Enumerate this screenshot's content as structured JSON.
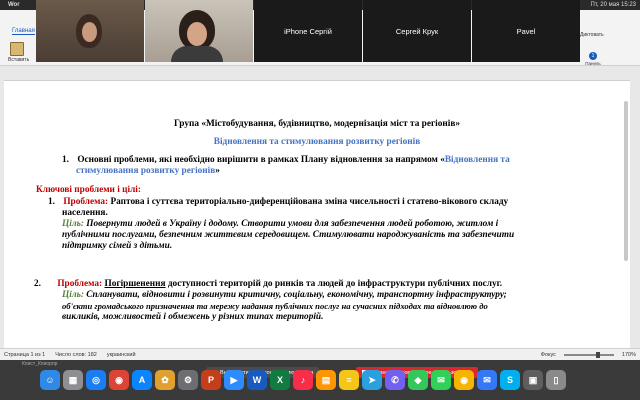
{
  "menubar": {
    "app": "Wor",
    "clock": "Пт, 20 мая  15:23"
  },
  "ribbon": {
    "home_tab": "Главная",
    "paste_label": "Вставить",
    "dictation": "Диктовать",
    "panel_label": "Панель стилей"
  },
  "tiles": [
    {
      "name": ""
    },
    {
      "name": ""
    },
    {
      "name": "iPhone Сергій"
    },
    {
      "name": "Сергей Крук"
    },
    {
      "name": "Pavel"
    }
  ],
  "doc": {
    "group_title": "Група «Містобудування, будівництво, модернізація міст та регіонів»",
    "subtitle": "Відновлення та стимулювання розвитку регіонів",
    "item1_num": "1.",
    "item1_text": "Основні проблеми, які необхідно вирішити в рамках Плану відновлення за напрямом «",
    "item1_blue": "Відновлення та",
    "item1_blue2": "стимулювання розвитку регіонів",
    "item1_end": "»",
    "key_problems": "Ключові проблеми і цілі:",
    "p1_num": "1.",
    "p1_label": "Проблема:",
    "p1_text": "Раптова і суттєва територіально-диференційована зміна чисельності і статево-вікового складу",
    "p1_text2": "населення.",
    "p1_goal_label": "Ціль:",
    "p1_goal": "Повернути людей в Україну і додому. Створити умови для забезпечення людей роботою, житлом і",
    "p1_goal2": "публічними послугами, безпечним життєвим середовищем. Стимулювати народжуваність та забезпечити",
    "p1_goal3": "підтримку сімей з дітьми.",
    "p2_num": "2.",
    "p2_label": "Проблема:",
    "p2_under": "Погіршенення",
    "p2_text": "доступності територій до ринків та людей до інфраструктури публічних послуг.",
    "p2_goal_label": "Ціль:",
    "p2_goal": "Спланувати, відновити і розвинути критичну, соціальну, економічну, транспортну інфраструктуру;",
    "p2_goal2": "об'єкти громадського призначення та мережу надання публічних послуг на сучасних підходах та відновлюю до",
    "p2_goal3": "викликів, можливостей і обмежень у різних типах територій."
  },
  "statusbar": {
    "page": "Страница 1 из 1",
    "words": "Число слов: 182",
    "lang": "украинский",
    "focus": "Фокус",
    "zoom": "170%"
  },
  "dock": {
    "label": "Кпист_Кпиорпр",
    "share_banner": "Вы запустили демонстрацию экрана",
    "stop_banner": "Остановить совместное использование",
    "icons": [
      {
        "name": "finder-icon",
        "glyph": "☺",
        "color": "#2e8ae6"
      },
      {
        "name": "launchpad-icon",
        "glyph": "▦",
        "color": "#8e8e93"
      },
      {
        "name": "safari-icon",
        "glyph": "◎",
        "color": "#1c7cf2"
      },
      {
        "name": "chrome-icon",
        "glyph": "◉",
        "color": "#db4437"
      },
      {
        "name": "appstore-icon",
        "glyph": "A",
        "color": "#0a84ff"
      },
      {
        "name": "photos-icon",
        "glyph": "✿",
        "color": "#e0a030"
      },
      {
        "name": "settings-icon",
        "glyph": "⚙",
        "color": "#6d6d72"
      },
      {
        "name": "powerpoint-icon",
        "glyph": "P",
        "color": "#c43e1c"
      },
      {
        "name": "zoom-icon",
        "glyph": "▶",
        "color": "#2d8cff"
      },
      {
        "name": "word-icon",
        "glyph": "W",
        "color": "#185abd"
      },
      {
        "name": "excel-icon",
        "glyph": "X",
        "color": "#107c41"
      },
      {
        "name": "music-icon",
        "glyph": "♪",
        "color": "#fa2d48"
      },
      {
        "name": "books-icon",
        "glyph": "▤",
        "color": "#ff9500"
      },
      {
        "name": "notes-icon",
        "glyph": "≡",
        "color": "#f5c518"
      },
      {
        "name": "telegram-icon",
        "glyph": "➤",
        "color": "#2aa1de"
      },
      {
        "name": "viber-icon",
        "glyph": "✆",
        "color": "#7360f2"
      },
      {
        "name": "maps-icon",
        "glyph": "◆",
        "color": "#34c759"
      },
      {
        "name": "messages-icon",
        "glyph": "✉",
        "color": "#30d158"
      },
      {
        "name": "chrome2-icon",
        "glyph": "◉",
        "color": "#f4b400"
      },
      {
        "name": "mail-icon",
        "glyph": "✉",
        "color": "#3478f6"
      },
      {
        "name": "skype-icon",
        "glyph": "S",
        "color": "#00aff0"
      },
      {
        "name": "screenshot-icon",
        "glyph": "▣",
        "color": "#5e5e5e"
      },
      {
        "name": "trash-icon",
        "glyph": "▯",
        "color": "#8a8a8a"
      }
    ]
  }
}
